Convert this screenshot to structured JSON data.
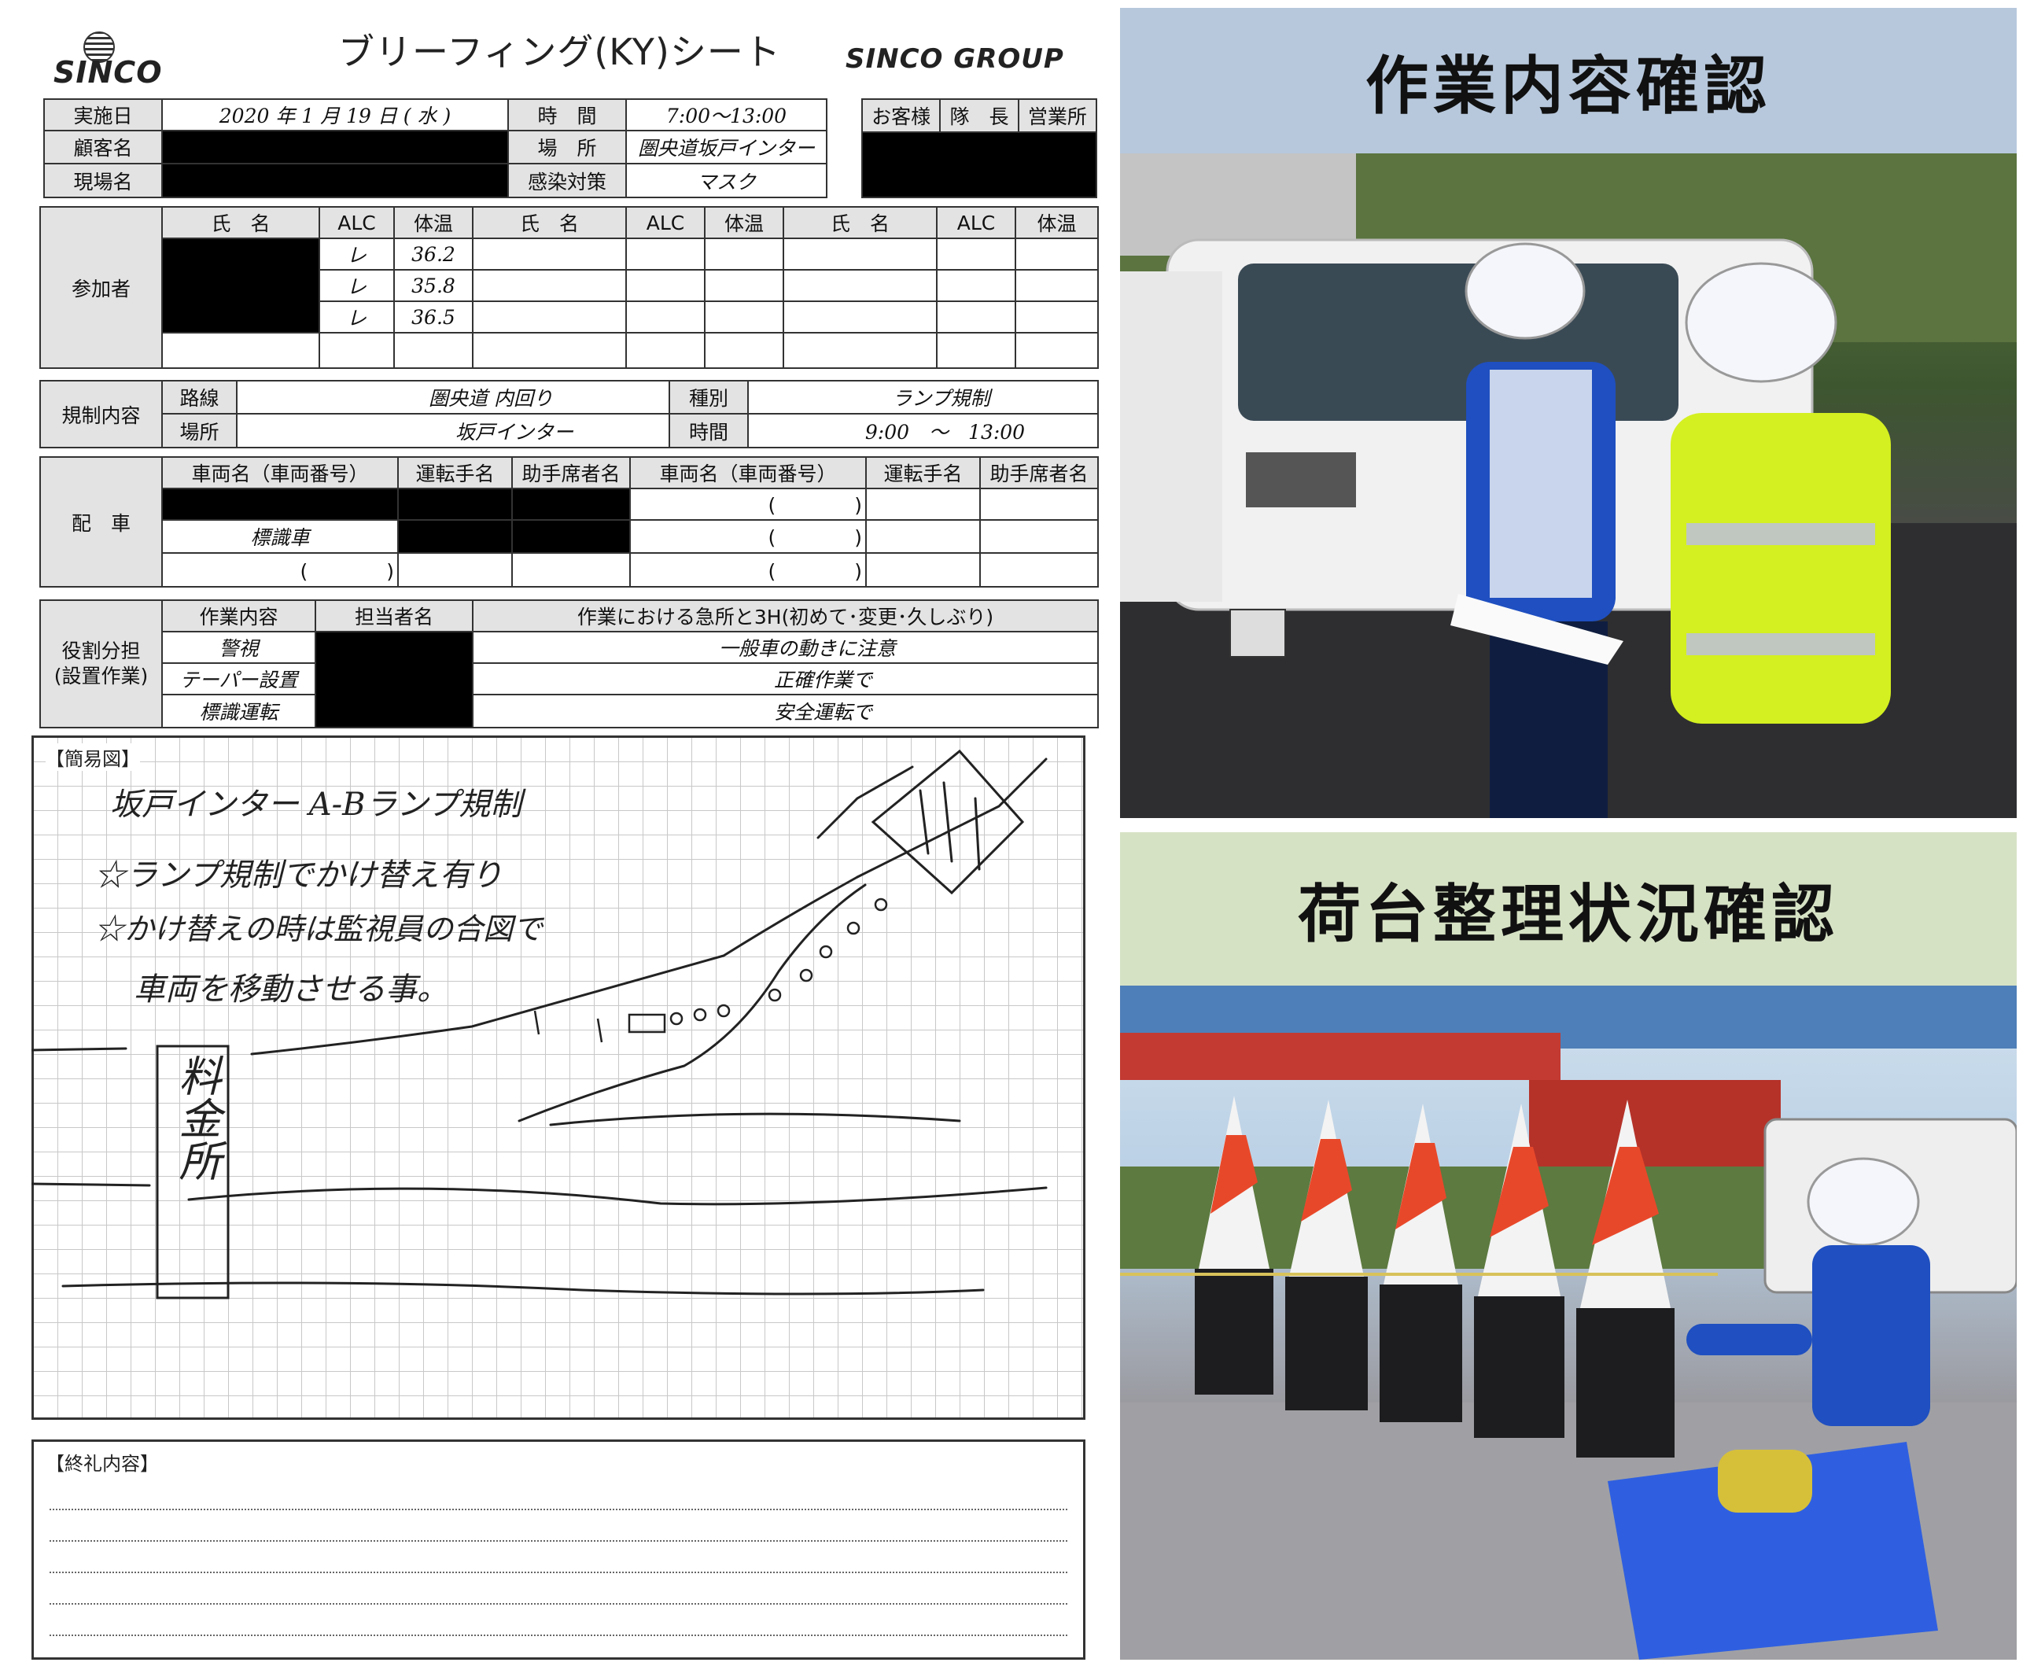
{
  "sheet": {
    "logo_left": "SINCO",
    "title": "ブリーフィング(KY)シート",
    "logo_right": "SINCO GROUP",
    "header": {
      "date_label": "実施日",
      "date_value": "2020 年  1  月 19  日 ( 水 )",
      "customer_label": "顧客名",
      "site_label": "現場名",
      "time_label": "時　間",
      "time_value": "7:00〜13:00",
      "place_label": "場　所",
      "place_value": "圏央道坂戸インター",
      "infection_label": "感染対策",
      "infection_value": "マスク",
      "stamp_labels": [
        "お客様",
        "隊　長",
        "営業所"
      ]
    },
    "participants": {
      "label": "参加者",
      "col_name": "氏　名",
      "col_alc": "ALC",
      "col_temp": "体温",
      "rows": [
        {
          "alc": "レ",
          "temp": "36.2"
        },
        {
          "alc": "レ",
          "temp": "35.8"
        },
        {
          "alc": "レ",
          "temp": "36.5"
        }
      ]
    },
    "regulation": {
      "label": "規制内容",
      "route_label": "路線",
      "route_value": "圏央道 内回り",
      "place_label": "場所",
      "place_value": "坂戸インター",
      "type_label": "種別",
      "type_value": "ランプ規制",
      "time_label": "時間",
      "time_value": "9:00　〜　13:00"
    },
    "vehicles": {
      "label": "配　車",
      "col_vehicle": "車両名（車両番号）",
      "col_driver": "運転手名",
      "col_assistant": "助手席者名",
      "row_vehicle": "標識車",
      "paren": "(　　　　)"
    },
    "roles": {
      "label": "役割分担",
      "sublabel": "(設置作業)",
      "col_task": "作業内容",
      "col_person": "担当者名",
      "col_points": "作業における急所と3H(初めて･変更･久しぶり)",
      "tasks": [
        "警視",
        "テーパー設置",
        "標識運転"
      ],
      "points": [
        "一般車の動きに注意",
        "正確作業で",
        "安全運転で"
      ]
    },
    "sketch": {
      "label": "【簡易図】",
      "line1": "坂戸インター A-Bランプ規制",
      "line2": "☆ランプ規制でかけ替え有り",
      "line3": "☆かけ替えの時は監視員の合図で",
      "line4": "車両を移動させる事。",
      "tollgate": [
        "料",
        "金",
        "所"
      ]
    },
    "closing": {
      "label": "【終礼内容】"
    }
  },
  "panels": {
    "top_banner": "作業内容確認",
    "bottom_banner": "荷台整理状況確認"
  },
  "colors": {
    "top_banner_bg": "#b7c8dc",
    "bottom_banner_bg": "#d6e2c4",
    "cone_orange": "#e8482a",
    "vest_yellow": "#d4f020",
    "uniform_blue": "#1f4fc0"
  }
}
